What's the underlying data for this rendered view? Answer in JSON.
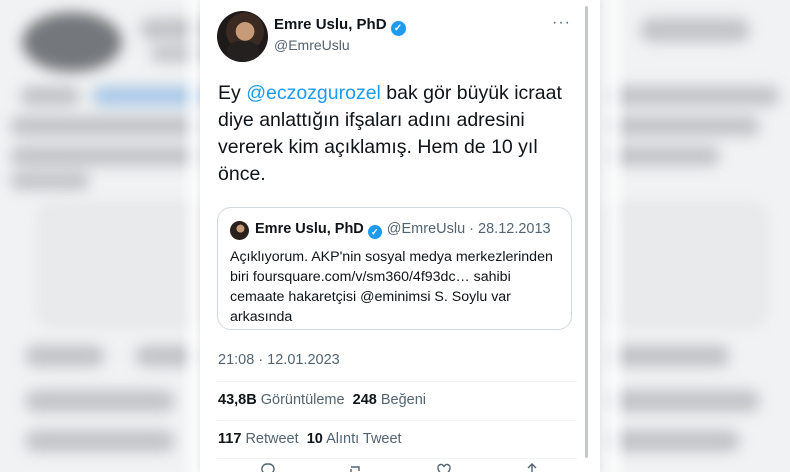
{
  "tweet": {
    "author_name": "Emre Uslu, PhD",
    "author_handle": "@EmreUslu",
    "verified_mark": "✓",
    "more_icon": "···",
    "text_prefix": "Ey ",
    "mention": "@eczozgurozel",
    "text_suffix": " bak gör büyük icraat diye anlattığın ifşaları adını adresini vererek kim açıklamış. Hem de 10 yıl önce.",
    "timestamp": "21:08 · 12.01.2023",
    "views_count": "43,8B",
    "views_label": "Görüntüleme",
    "likes_count": "248",
    "likes_label": "Beğeni",
    "retweets_count": "117",
    "retweets_label": "Retweet",
    "quotes_count": "10",
    "quotes_label": "Alıntı Tweet"
  },
  "quoted_tweet": {
    "author_name": "Emre Uslu, PhD",
    "verified_mark": "✓",
    "meta": "@EmreUslu · 28.12.2013",
    "text": "Açıklıyorum. AKP'nin sosyal medya merkezlerinden biri foursquare.com/v/sm360/4f93dc… sahibi cemaate hakaretçisi @eminimsi S. Soylu var arkasında"
  },
  "colors": {
    "link_blue": "#1d9bf0",
    "secondary_text": "#536471",
    "primary_text": "#0f1419"
  }
}
